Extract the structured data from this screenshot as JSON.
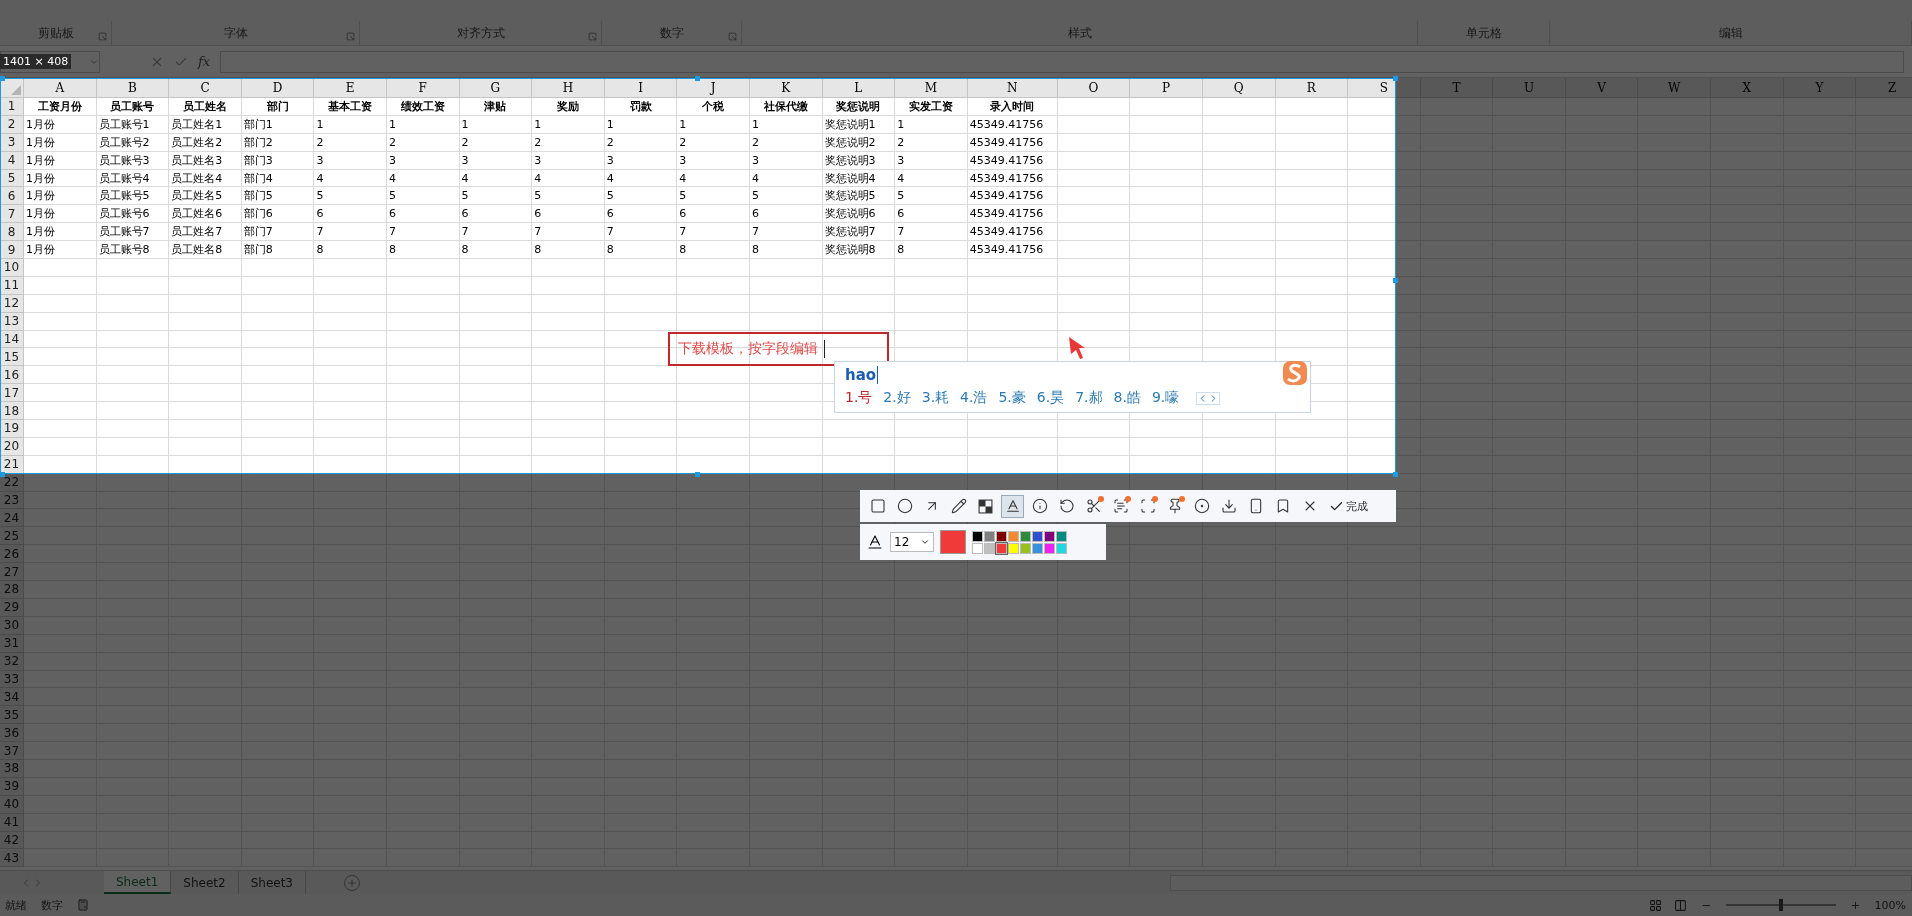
{
  "ribbon": {
    "groups": [
      {
        "label": "剪贴板",
        "launcher": true
      },
      {
        "label": "字体",
        "launcher": true
      },
      {
        "label": "对齐方式",
        "launcher": true
      },
      {
        "label": "数字",
        "launcher": true
      },
      {
        "label": "样式",
        "launcher": false
      },
      {
        "label": "单元格",
        "launcher": false
      },
      {
        "label": "编辑",
        "launcher": false
      }
    ]
  },
  "capture": {
    "size_label": "1401 × 408"
  },
  "formula_bar": {
    "function_label": "fx"
  },
  "sheet": {
    "columns": [
      "A",
      "B",
      "C",
      "D",
      "E",
      "F",
      "G",
      "H",
      "I",
      "J",
      "K",
      "L",
      "M",
      "N",
      "O",
      "P",
      "Q",
      "R",
      "S",
      "T",
      "U",
      "V",
      "W",
      "X",
      "Y",
      "Z"
    ],
    "row_numbers": [
      "1",
      "2",
      "3",
      "4",
      "5",
      "6",
      "7",
      "8",
      "9",
      "10",
      "11",
      "12",
      "13",
      "14",
      "15",
      "16",
      "17",
      "18",
      "19",
      "20",
      "21",
      "22",
      "23",
      "24",
      "25",
      "26",
      "27",
      "28",
      "29",
      "30",
      "31",
      "32",
      "33",
      "34",
      "35",
      "36",
      "37",
      "38",
      "39",
      "40",
      "41",
      "42",
      "43"
    ],
    "rows": [
      [
        "工资月份",
        "员工账号",
        "员工姓名",
        "部门",
        "基本工资",
        "绩效工资",
        "津贴",
        "奖励",
        "罚款",
        "个税",
        "社保代缴",
        "奖惩说明",
        "实发工资",
        "录入时间"
      ],
      [
        "1月份",
        "员工账号1",
        "员工姓名1",
        "部门1",
        "1",
        "1",
        "1",
        "1",
        "1",
        "1",
        "1",
        "奖惩说明1",
        "1",
        "45349.41756"
      ],
      [
        "1月份",
        "员工账号2",
        "员工姓名2",
        "部门2",
        "2",
        "2",
        "2",
        "2",
        "2",
        "2",
        "2",
        "奖惩说明2",
        "2",
        "45349.41756"
      ],
      [
        "1月份",
        "员工账号3",
        "员工姓名3",
        "部门3",
        "3",
        "3",
        "3",
        "3",
        "3",
        "3",
        "3",
        "奖惩说明3",
        "3",
        "45349.41756"
      ],
      [
        "1月份",
        "员工账号4",
        "员工姓名4",
        "部门4",
        "4",
        "4",
        "4",
        "4",
        "4",
        "4",
        "4",
        "奖惩说明4",
        "4",
        "45349.41756"
      ],
      [
        "1月份",
        "员工账号5",
        "员工姓名5",
        "部门5",
        "5",
        "5",
        "5",
        "5",
        "5",
        "5",
        "5",
        "奖惩说明5",
        "5",
        "45349.41756"
      ],
      [
        "1月份",
        "员工账号6",
        "员工姓名6",
        "部门6",
        "6",
        "6",
        "6",
        "6",
        "6",
        "6",
        "6",
        "奖惩说明6",
        "6",
        "45349.41756"
      ],
      [
        "1月份",
        "员工账号7",
        "员工姓名7",
        "部门7",
        "7",
        "7",
        "7",
        "7",
        "7",
        "7",
        "7",
        "奖惩说明7",
        "7",
        "45349.41756"
      ],
      [
        "1月份",
        "员工账号8",
        "员工姓名8",
        "部门8",
        "8",
        "8",
        "8",
        "8",
        "8",
        "8",
        "8",
        "奖惩说明8",
        "8",
        "45349.41756"
      ]
    ]
  },
  "annotation": {
    "text": "下载模板，按字段编辑"
  },
  "ime": {
    "composition": "hao",
    "candidates": [
      {
        "label": "1.号",
        "selected": true
      },
      {
        "label": "2.好",
        "selected": false
      },
      {
        "label": "3.耗",
        "selected": false
      },
      {
        "label": "4.浩",
        "selected": false
      },
      {
        "label": "5.豪",
        "selected": false
      },
      {
        "label": "6.昊",
        "selected": false
      },
      {
        "label": "7.郝",
        "selected": false
      },
      {
        "label": "8.皓",
        "selected": false
      },
      {
        "label": "9.嚎",
        "selected": false
      }
    ]
  },
  "toolbar": {
    "tools": [
      {
        "kind": "rectangle",
        "selected": false,
        "dot": false
      },
      {
        "kind": "ellipse",
        "selected": false,
        "dot": false
      },
      {
        "kind": "arrow",
        "selected": false,
        "dot": false
      },
      {
        "kind": "pencil",
        "selected": false,
        "dot": false
      },
      {
        "kind": "mosaic",
        "selected": false,
        "dot": false
      },
      {
        "kind": "text",
        "selected": true,
        "dot": false
      },
      {
        "kind": "number",
        "selected": false,
        "dot": false
      },
      {
        "kind": "undo",
        "selected": false,
        "dot": false
      },
      {
        "kind": "cut",
        "selected": false,
        "dot": true
      },
      {
        "kind": "ocr",
        "selected": false,
        "dot": true
      },
      {
        "kind": "scan",
        "selected": false,
        "dot": true
      },
      {
        "kind": "pin",
        "selected": false,
        "dot": true
      },
      {
        "kind": "record",
        "selected": false,
        "dot": false
      },
      {
        "kind": "download",
        "selected": false,
        "dot": false
      },
      {
        "kind": "phone",
        "selected": false,
        "dot": false
      },
      {
        "kind": "bookmark",
        "selected": false,
        "dot": false
      },
      {
        "kind": "close",
        "selected": false,
        "dot": false
      }
    ],
    "done_label": "完成"
  },
  "text_options": {
    "size": "12",
    "palette": [
      {
        "color": "#000000",
        "current": false
      },
      {
        "color": "#808080",
        "current": false
      },
      {
        "color": "#800000",
        "current": false
      },
      {
        "color": "#f08a30",
        "current": false
      },
      {
        "color": "#2e8b3a",
        "current": false
      },
      {
        "color": "#3050d0",
        "current": false
      },
      {
        "color": "#800080",
        "current": false
      },
      {
        "color": "#008b80",
        "current": false
      },
      {
        "color": "#ffffff",
        "current": false
      },
      {
        "color": "#c0c0c0",
        "current": false
      },
      {
        "color": "#f03a3a",
        "current": true
      },
      {
        "color": "#ffff00",
        "current": false
      },
      {
        "color": "#98c020",
        "current": false
      },
      {
        "color": "#3890e0",
        "current": false
      },
      {
        "color": "#f020f0",
        "current": false
      },
      {
        "color": "#20d8e0",
        "current": false
      }
    ]
  },
  "sheet_tabs": [
    {
      "label": "Sheet1",
      "selected": true
    },
    {
      "label": "Sheet2",
      "selected": false
    },
    {
      "label": "Sheet3",
      "selected": false
    }
  ],
  "status_bar": {
    "items": [
      "就绪",
      "数字"
    ],
    "zoom_slider": {
      "level": 0.5
    },
    "zoom": "100%"
  }
}
